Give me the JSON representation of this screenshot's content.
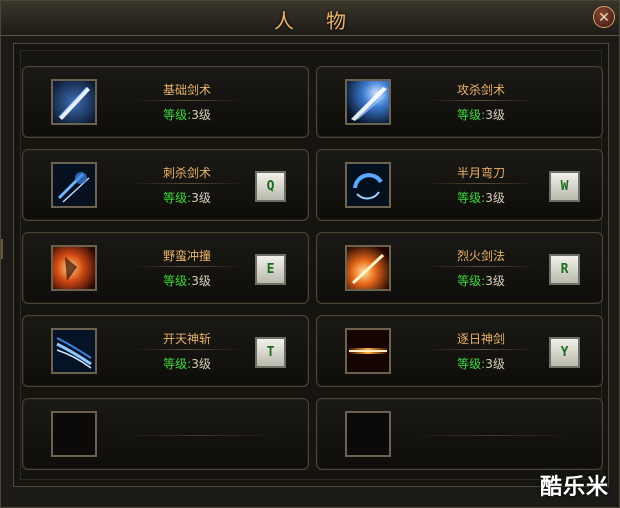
{
  "window": {
    "title": "人物",
    "close_label": "✕"
  },
  "skills": [
    {
      "name": "基础剑术",
      "level_label": "等级:",
      "level_value": "3级",
      "hotkey": "",
      "icon": "sword-thrust-icon"
    },
    {
      "name": "攻杀剑术",
      "level_label": "等级:",
      "level_value": "3级",
      "hotkey": "",
      "icon": "sword-strike-icon"
    },
    {
      "name": "刺杀剑术",
      "level_label": "等级:",
      "level_value": "3级",
      "hotkey": "Q",
      "icon": "stab-icon"
    },
    {
      "name": "半月弯刀",
      "level_label": "等级:",
      "level_value": "3级",
      "hotkey": "W",
      "icon": "half-moon-icon"
    },
    {
      "name": "野蛮冲撞",
      "level_label": "等级:",
      "level_value": "3级",
      "hotkey": "E",
      "icon": "charge-icon"
    },
    {
      "name": "烈火剑法",
      "level_label": "等级:",
      "level_value": "3级",
      "hotkey": "R",
      "icon": "fire-sword-icon"
    },
    {
      "name": "开天神斩",
      "level_label": "等级:",
      "level_value": "3级",
      "hotkey": "T",
      "icon": "heaven-slash-icon"
    },
    {
      "name": "逐日神剑",
      "level_label": "等级:",
      "level_value": "3级",
      "hotkey": "Y",
      "icon": "sun-sword-icon"
    }
  ],
  "watermark": "酷乐米"
}
